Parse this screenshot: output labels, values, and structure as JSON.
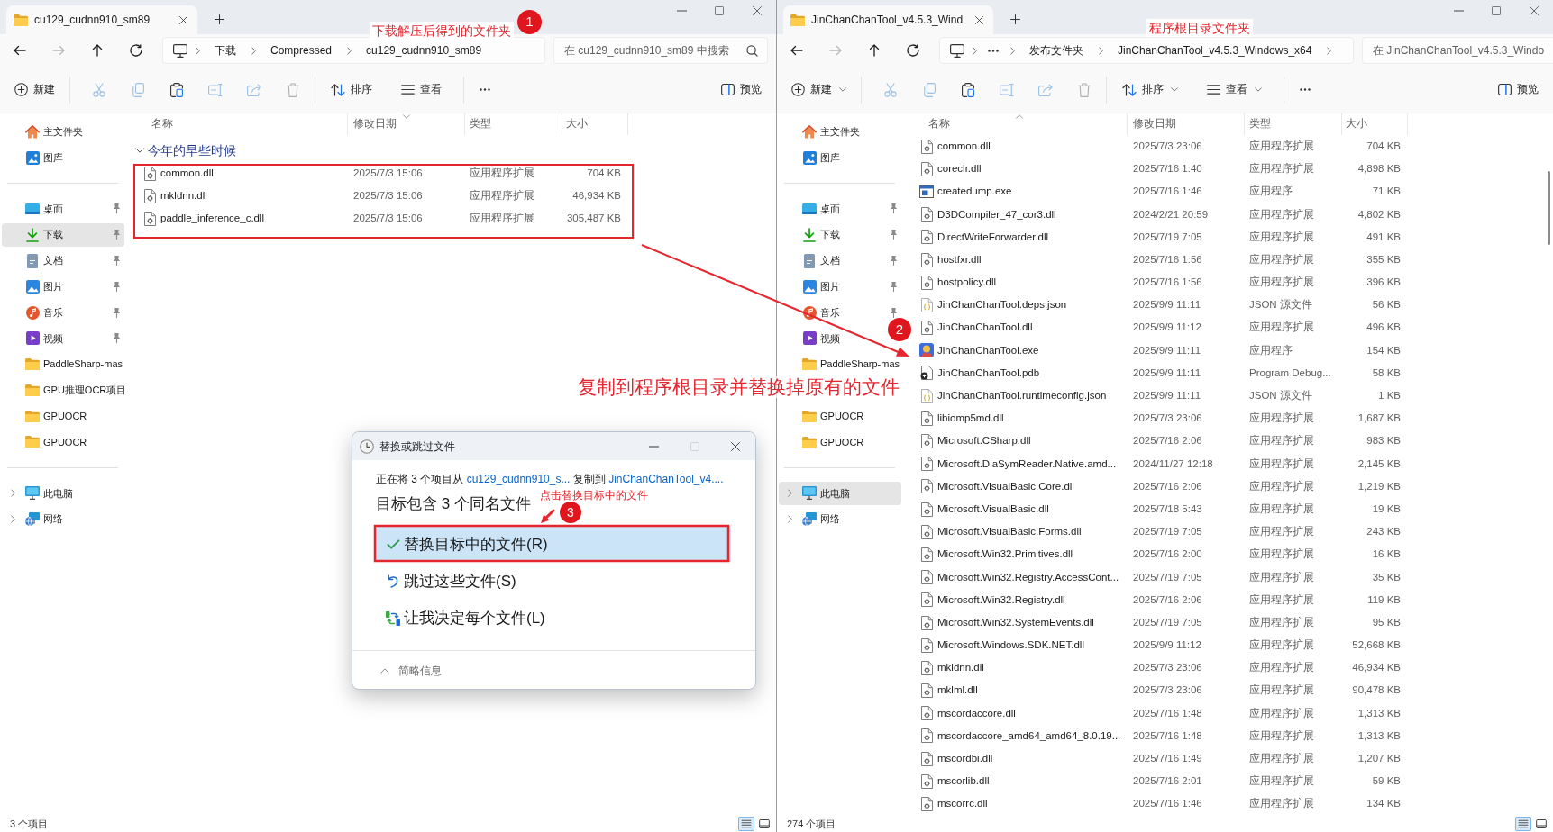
{
  "windows": [
    {
      "tab": {
        "title": "cu129_cudnn910_sm89",
        "selected": true
      },
      "nav_buttons": [
        {
          "kind": "back",
          "disabled": false
        },
        {
          "kind": "forward",
          "disabled": true
        },
        {
          "kind": "up",
          "disabled": false
        },
        {
          "kind": "refresh",
          "disabled": false
        }
      ],
      "address": {
        "crumbs": [
          {
            "kind": "folder",
            "text": "下载"
          },
          {
            "kind": "folder",
            "text": "Compressed"
          },
          {
            "kind": "folder",
            "text": "cu129_cudnn910_sm89"
          }
        ],
        "trailing_chevron": false
      },
      "search": {
        "placeholder": "在 cu129_cudnn910_sm89 中搜索"
      },
      "toolbar": {
        "new": "新建",
        "sort": "排序",
        "view": "查看",
        "preview": "预览",
        "dropdown_carets": false,
        "actions": [
          {
            "kind": "cut",
            "disabled": true
          },
          {
            "kind": "copy",
            "disabled": true
          },
          {
            "kind": "paste",
            "disabled": false
          },
          {
            "kind": "rename",
            "disabled": true
          },
          {
            "kind": "share",
            "disabled": true
          },
          {
            "kind": "delete",
            "disabled": true
          }
        ]
      },
      "sidebar": [
        {
          "kind": "home",
          "label": "主文件夹",
          "selected": false,
          "pinned": false
        },
        {
          "kind": "gallery",
          "label": "图库",
          "selected": false,
          "pinned": false
        },
        {
          "kind": "separator"
        },
        {
          "kind": "desktop",
          "label": "桌面",
          "selected": false,
          "pinned": true
        },
        {
          "kind": "downloads",
          "label": "下载",
          "selected": true,
          "pinned": true
        },
        {
          "kind": "documents",
          "label": "文档",
          "selected": false,
          "pinned": true
        },
        {
          "kind": "pictures",
          "label": "图片",
          "selected": false,
          "pinned": true
        },
        {
          "kind": "music",
          "label": "音乐",
          "selected": false,
          "pinned": true
        },
        {
          "kind": "videos",
          "label": "视频",
          "selected": false,
          "pinned": true
        },
        {
          "kind": "folder",
          "label": "PaddleSharp-mas",
          "selected": false,
          "pinned": false
        },
        {
          "kind": "folder",
          "label": "GPU推理OCR项目",
          "selected": false,
          "pinned": false
        },
        {
          "kind": "folder",
          "label": "GPUOCR",
          "selected": false,
          "pinned": false
        },
        {
          "kind": "folder",
          "label": "GPUOCR",
          "selected": false,
          "pinned": false
        },
        {
          "kind": "separator"
        },
        {
          "kind": "computer",
          "label": "此电脑",
          "selected": false,
          "pinned": false,
          "expanded": false
        },
        {
          "kind": "network",
          "label": "网络",
          "selected": false,
          "pinned": false,
          "expanded": false
        }
      ],
      "columns": [
        {
          "label": "名称",
          "sorted": false
        },
        {
          "label": "修改日期",
          "sorted": true,
          "descending": true
        },
        {
          "label": "类型",
          "sorted": false
        },
        {
          "label": "大小",
          "sorted": false
        }
      ],
      "group": {
        "label": "今年的早些时候",
        "expanded": true
      },
      "files": [
        {
          "kind": "dll",
          "name": "common.dll",
          "date": "2025/7/3 15:06",
          "type": "应用程序扩展",
          "size": "704 KB"
        },
        {
          "kind": "dll",
          "name": "mkldnn.dll",
          "date": "2025/7/3 15:06",
          "type": "应用程序扩展",
          "size": "46,934 KB"
        },
        {
          "kind": "dll",
          "name": "paddle_inference_c.dll",
          "date": "2025/7/3 15:06",
          "type": "应用程序扩展",
          "size": "305,487 KB"
        }
      ],
      "status": {
        "count": "3 个项目",
        "views": [
          {
            "kind": "details",
            "selected": true
          },
          {
            "kind": "tiles",
            "selected": false
          }
        ]
      }
    },
    {
      "tab": {
        "title": "JinChanChanTool_v4.5.3_Wind",
        "selected": true
      },
      "nav_buttons": [
        {
          "kind": "back",
          "disabled": false
        },
        {
          "kind": "forward",
          "disabled": true
        },
        {
          "kind": "up",
          "disabled": false
        },
        {
          "kind": "refresh",
          "disabled": false
        }
      ],
      "address": {
        "crumbs": [
          {
            "kind": "overflow"
          },
          {
            "kind": "folder",
            "text": "发布文件夹"
          },
          {
            "kind": "folder",
            "text": "JinChanChanTool_v4.5.3_Windows_x64"
          }
        ],
        "trailing_chevron": true
      },
      "search": {
        "placeholder": "在 JinChanChanTool_v4.5.3_Windo"
      },
      "toolbar": {
        "new": "新建",
        "sort": "排序",
        "view": "查看",
        "preview": "预览",
        "dropdown_carets": true,
        "actions": [
          {
            "kind": "cut",
            "disabled": true
          },
          {
            "kind": "copy",
            "disabled": true
          },
          {
            "kind": "paste",
            "disabled": false
          },
          {
            "kind": "rename",
            "disabled": true
          },
          {
            "kind": "share",
            "disabled": true
          },
          {
            "kind": "delete",
            "disabled": true
          }
        ]
      },
      "sidebar": [
        {
          "kind": "home",
          "label": "主文件夹",
          "selected": false,
          "pinned": false
        },
        {
          "kind": "gallery",
          "label": "图库",
          "selected": false,
          "pinned": false
        },
        {
          "kind": "separator"
        },
        {
          "kind": "desktop",
          "label": "桌面",
          "selected": false,
          "pinned": true
        },
        {
          "kind": "downloads",
          "label": "下载",
          "selected": false,
          "pinned": true
        },
        {
          "kind": "documents",
          "label": "文档",
          "selected": false,
          "pinned": true
        },
        {
          "kind": "pictures",
          "label": "图片",
          "selected": false,
          "pinned": true
        },
        {
          "kind": "music",
          "label": "音乐",
          "selected": false,
          "pinned": true
        },
        {
          "kind": "videos",
          "label": "视频",
          "selected": false,
          "pinned": false
        },
        {
          "kind": "folder",
          "label": "PaddleSharp-mas",
          "selected": false,
          "pinned": false
        },
        {
          "kind": "folder",
          "label": "GPUOCR",
          "selected": false,
          "pinned": false
        },
        {
          "kind": "folder",
          "label": "GPUOCR",
          "selected": false,
          "pinned": false
        },
        {
          "kind": "separator"
        },
        {
          "kind": "computer",
          "label": "此电脑",
          "selected": true,
          "pinned": false,
          "expanded": false
        },
        {
          "kind": "network",
          "label": "网络",
          "selected": false,
          "pinned": false,
          "expanded": false
        }
      ],
      "columns": [
        {
          "label": "名称",
          "sorted": true,
          "descending": false
        },
        {
          "label": "修改日期",
          "sorted": false
        },
        {
          "label": "类型",
          "sorted": false
        },
        {
          "label": "大小",
          "sorted": false
        }
      ],
      "files": [
        {
          "kind": "dll",
          "name": "common.dll",
          "date": "2025/7/3 23:06",
          "type": "应用程序扩展",
          "size": "704 KB"
        },
        {
          "kind": "dll",
          "name": "coreclr.dll",
          "date": "2025/7/16 1:40",
          "type": "应用程序扩展",
          "size": "4,898 KB"
        },
        {
          "kind": "exe",
          "name": "createdump.exe",
          "date": "2025/7/16 1:46",
          "type": "应用程序",
          "size": "71 KB"
        },
        {
          "kind": "dll",
          "name": "D3DCompiler_47_cor3.dll",
          "date": "2024/2/21 20:59",
          "type": "应用程序扩展",
          "size": "4,802 KB"
        },
        {
          "kind": "dll",
          "name": "DirectWriteForwarder.dll",
          "date": "2025/7/19 7:05",
          "type": "应用程序扩展",
          "size": "491 KB"
        },
        {
          "kind": "dll",
          "name": "hostfxr.dll",
          "date": "2025/7/16 1:56",
          "type": "应用程序扩展",
          "size": "355 KB"
        },
        {
          "kind": "dll",
          "name": "hostpolicy.dll",
          "date": "2025/7/16 1:56",
          "type": "应用程序扩展",
          "size": "396 KB"
        },
        {
          "kind": "json",
          "name": "JinChanChanTool.deps.json",
          "date": "2025/9/9 11:11",
          "type": "JSON 源文件",
          "size": "56 KB"
        },
        {
          "kind": "dll",
          "name": "JinChanChanTool.dll",
          "date": "2025/9/9 11:12",
          "type": "应用程序扩展",
          "size": "496 KB"
        },
        {
          "kind": "app",
          "name": "JinChanChanTool.exe",
          "date": "2025/9/9 11:11",
          "type": "应用程序",
          "size": "154 KB"
        },
        {
          "kind": "pdb",
          "name": "JinChanChanTool.pdb",
          "date": "2025/9/9 11:11",
          "type": "Program Debug...",
          "size": "58 KB"
        },
        {
          "kind": "json",
          "name": "JinChanChanTool.runtimeconfig.json",
          "date": "2025/9/9 11:11",
          "type": "JSON 源文件",
          "size": "1 KB"
        },
        {
          "kind": "dll",
          "name": "libiomp5md.dll",
          "date": "2025/7/3 23:06",
          "type": "应用程序扩展",
          "size": "1,687 KB"
        },
        {
          "kind": "dll",
          "name": "Microsoft.CSharp.dll",
          "date": "2025/7/16 2:06",
          "type": "应用程序扩展",
          "size": "983 KB"
        },
        {
          "kind": "dll",
          "name": "Microsoft.DiaSymReader.Native.amd...",
          "date": "2024/11/27 12:18",
          "type": "应用程序扩展",
          "size": "2,145 KB"
        },
        {
          "kind": "dll",
          "name": "Microsoft.VisualBasic.Core.dll",
          "date": "2025/7/16 2:06",
          "type": "应用程序扩展",
          "size": "1,219 KB"
        },
        {
          "kind": "dll",
          "name": "Microsoft.VisualBasic.dll",
          "date": "2025/7/18 5:43",
          "type": "应用程序扩展",
          "size": "19 KB"
        },
        {
          "kind": "dll",
          "name": "Microsoft.VisualBasic.Forms.dll",
          "date": "2025/7/19 7:05",
          "type": "应用程序扩展",
          "size": "243 KB"
        },
        {
          "kind": "dll",
          "name": "Microsoft.Win32.Primitives.dll",
          "date": "2025/7/16 2:00",
          "type": "应用程序扩展",
          "size": "16 KB"
        },
        {
          "kind": "dll",
          "name": "Microsoft.Win32.Registry.AccessCont...",
          "date": "2025/7/19 7:05",
          "type": "应用程序扩展",
          "size": "35 KB"
        },
        {
          "kind": "dll",
          "name": "Microsoft.Win32.Registry.dll",
          "date": "2025/7/16 2:06",
          "type": "应用程序扩展",
          "size": "119 KB"
        },
        {
          "kind": "dll",
          "name": "Microsoft.Win32.SystemEvents.dll",
          "date": "2025/7/19 7:05",
          "type": "应用程序扩展",
          "size": "95 KB"
        },
        {
          "kind": "dll",
          "name": "Microsoft.Windows.SDK.NET.dll",
          "date": "2025/9/9 11:12",
          "type": "应用程序扩展",
          "size": "52,668 KB"
        },
        {
          "kind": "dll",
          "name": "mkldnn.dll",
          "date": "2025/7/3 23:06",
          "type": "应用程序扩展",
          "size": "46,934 KB"
        },
        {
          "kind": "dll",
          "name": "mklml.dll",
          "date": "2025/7/3 23:06",
          "type": "应用程序扩展",
          "size": "90,478 KB"
        },
        {
          "kind": "dll",
          "name": "mscordaccore.dll",
          "date": "2025/7/16 1:48",
          "type": "应用程序扩展",
          "size": "1,313 KB"
        },
        {
          "kind": "dll",
          "name": "mscordaccore_amd64_amd64_8.0.19...",
          "date": "2025/7/16 1:48",
          "type": "应用程序扩展",
          "size": "1,313 KB"
        },
        {
          "kind": "dll",
          "name": "mscordbi.dll",
          "date": "2025/7/16 1:49",
          "type": "应用程序扩展",
          "size": "1,207 KB"
        },
        {
          "kind": "dll",
          "name": "mscorlib.dll",
          "date": "2025/7/16 2:01",
          "type": "应用程序扩展",
          "size": "59 KB"
        },
        {
          "kind": "dll",
          "name": "mscorrc.dll",
          "date": "2025/7/16 1:46",
          "type": "应用程序扩展",
          "size": "134 KB"
        }
      ],
      "scrollbar": true,
      "status": {
        "count": "274 个项目",
        "views": [
          {
            "kind": "details",
            "selected": true
          },
          {
            "kind": "tiles",
            "selected": false
          }
        ]
      }
    }
  ],
  "dialog": {
    "title": "替换或跳过文件",
    "caption_buttons": [
      {
        "kind": "minimize",
        "disabled": false
      },
      {
        "kind": "maximize",
        "disabled": true
      },
      {
        "kind": "close",
        "disabled": false
      }
    ],
    "message": [
      {
        "kind": "text",
        "text": "正在将 3 个项目从 "
      },
      {
        "kind": "link",
        "text": "cu129_cudnn910_s..."
      },
      {
        "kind": "text",
        "text": " 复制到 "
      },
      {
        "kind": "link",
        "text": "JinChanChanTool_v4...."
      }
    ],
    "heading": "目标包含 3 个同名文件",
    "options": [
      {
        "kind": "replace",
        "label": "替换目标中的文件(R)",
        "selected": true
      },
      {
        "kind": "skip",
        "label": "跳过这些文件(S)",
        "selected": false
      },
      {
        "kind": "decide",
        "label": "让我决定每个文件(L)",
        "selected": false
      }
    ],
    "details_toggle": "简略信息"
  },
  "annotations": [
    {
      "kind": "note",
      "text": "下载解压后得到的文件夹"
    },
    {
      "kind": "badge",
      "text": "1"
    },
    {
      "kind": "note",
      "text": "程序根目录文件夹"
    },
    {
      "kind": "badge",
      "text": "2"
    },
    {
      "kind": "note",
      "text": "复制到程序根目录并替换掉原有的文件"
    },
    {
      "kind": "note",
      "text": "点击替换目标中的文件"
    },
    {
      "kind": "badge",
      "text": "3"
    }
  ]
}
